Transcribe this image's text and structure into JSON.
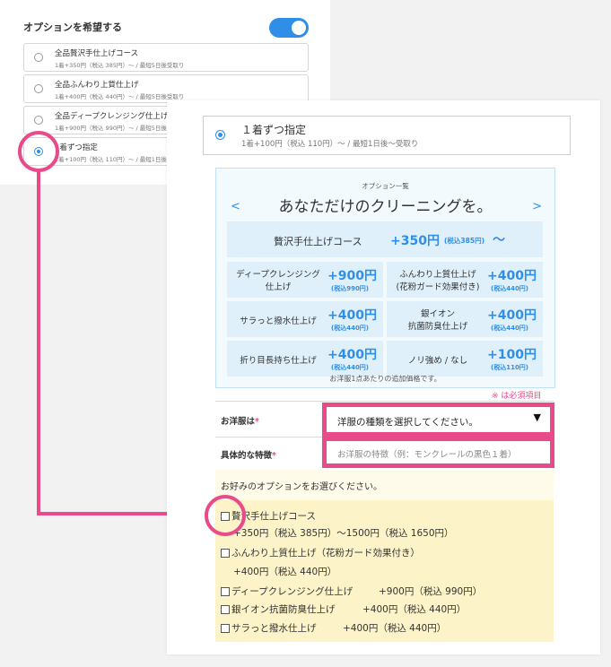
{
  "left_panel": {
    "title": "オプションを希望する",
    "toggle_on": true,
    "options": [
      {
        "name": "全品贅沢手仕上げコース",
        "detail": "1着+350円（税込 385円）〜 / 最短5日後受取り",
        "selected": false
      },
      {
        "name": "全品ふんわり上質仕上げ",
        "detail": "1着+400円（税込 440円）〜 / 最短5日後受取り",
        "selected": false
      },
      {
        "name": "全品ディープクレンジング仕上げ",
        "detail": "1着+900円（税込 990円）〜 / 最短5日後受取り",
        "selected": false
      },
      {
        "name": "1着ずつ指定",
        "detail": "1着+100円（税込 110円）〜 / 最短1日後受取り",
        "selected": true
      }
    ]
  },
  "right_panel": {
    "selected_option": {
      "name": "１着ずつ指定",
      "detail": "1着+100円（税込 110円）〜 / 最短1日後〜受取り"
    },
    "menu": {
      "small_title": "オプション一覧",
      "headline": "あなただけのクリーニングを。",
      "prev": "<",
      "next": ">",
      "top_item": {
        "label": "贅沢手仕上げコース",
        "price": "+350円",
        "tax": "(税込385円)",
        "suffix": "〜"
      },
      "items": [
        {
          "label": "ディープクレンジング\n仕上げ",
          "price": "+900円",
          "tax": "(税込990円)"
        },
        {
          "label": "ふんわり上質仕上げ\n(花粉ガード効果付き)",
          "price": "+400円",
          "tax": "(税込440円)"
        },
        {
          "label": "サラっと撥水仕上げ",
          "price": "+400円",
          "tax": "(税込440円)"
        },
        {
          "label": "銀イオン\n抗菌防臭仕上げ",
          "price": "+400円",
          "tax": "(税込440円)"
        },
        {
          "label": "折り目長持ち仕上げ",
          "price": "+400円",
          "tax": "(税込440円)"
        },
        {
          "label": "ノリ強め / なし",
          "price": "+100円",
          "tax": "(税込110円)"
        }
      ],
      "note": "お洋服1点あたりの追加価格です。"
    },
    "required_note": "※ は必須項目",
    "form": {
      "type_label": "お洋服は",
      "type_value": "洋服の種類を選択してください。",
      "feature_label": "具体的な特徴",
      "feature_placeholder": "お洋服の特徴（例：モンクレールの黒色１着）",
      "required_mark": "*"
    },
    "prompt": "お好みのオプションをお選びください。",
    "checkboxes": [
      {
        "label": "贅沢手仕上げコース",
        "price": "+350円（税込 385円）〜1500円（税込 1650円）",
        "checked": false
      },
      {
        "label": "ふんわり上質仕上げ（花粉ガード効果付き）",
        "price": "+400円（税込 440円）",
        "checked": false
      },
      {
        "label": "ディープクレンジング仕上げ",
        "price": "+900円（税込 990円）",
        "checked": false
      },
      {
        "label": "銀イオン抗菌防臭仕上げ",
        "price": "+400円（税込 440円）",
        "checked": false
      },
      {
        "label": "サラっと撥水仕上げ",
        "price": "+400円（税込 440円）",
        "checked": false
      }
    ]
  },
  "colors": {
    "accent": "#2f8fe8",
    "highlight": "#e94b8a"
  }
}
